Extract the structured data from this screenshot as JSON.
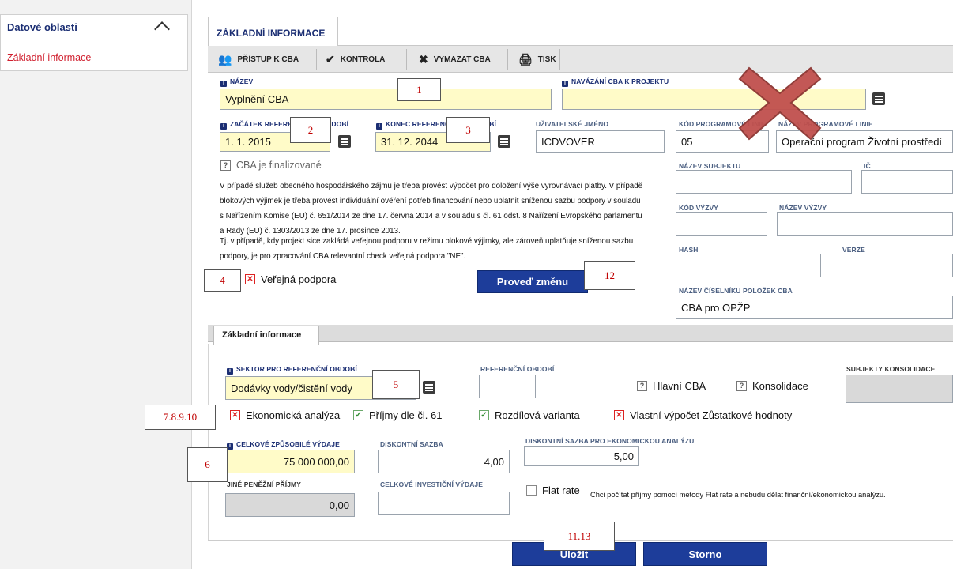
{
  "sidebar": {
    "section_title": "Datové oblasti",
    "item_active": "Základní informace"
  },
  "tabs": {
    "main": "ZÁKLADNÍ INFORMACE",
    "inner": "Základní informace"
  },
  "toolbar": {
    "access": "PŘÍSTUP K CBA",
    "check": "KONTROLA",
    "delete": "VYMAZAT CBA",
    "print": "TISK"
  },
  "form": {
    "nazev_label": "NÁZEV",
    "nazev_value": "Vyplnění CBA",
    "navazani_label": "NAVÁZÁNÍ CBA K PROJEKTU",
    "navazani_value": "",
    "zacatek_label": "ZAČÁTEK REFERENČNÍHO OBDOBÍ",
    "zacatek_value": "1. 1. 2015",
    "konec_label": "KONEC REFERENČNÍHO OBDOBÍ",
    "konec_value": "31. 12. 2044",
    "uziv_label": "UŽIVATELSKÉ JMÉNO",
    "uziv_value": "ICDVOVER",
    "kod_prog_label": "KÓD PROGRAMOVÉ LINIE",
    "kod_prog_value": "05",
    "nazev_prog_label": "NÁZEV PROGRAMOVÉ LINIE",
    "nazev_prog_value": "Operační program Životní prostředí",
    "finalized": "CBA je finalizované",
    "nazev_subjektu_label": "NÁZEV SUBJEKTU",
    "ic_label": "IČ",
    "kod_vyzvy_label": "KÓD VÝZVY",
    "nazev_vyzvy_label": "NÁZEV VÝZVY",
    "hash_label": "HASH",
    "verze_label": "VERZE",
    "ciselnik_label": "NÁZEV ČÍSELNÍKU POLOŽEK CBA",
    "ciselnik_value": "CBA pro OPŽP",
    "info_text_1": "V případě služeb obecného hospodářského zájmu je třeba provést výpočet pro doložení výše vyrovnávací platby. V případě blokových výjimek je třeba provést individuální ověření potřeb financování nebo uplatnit sníženou sazbu podpory v souladu s Nařízením Komise (EU) č. 651/2014 ze dne 17. června 2014 a v souladu s čl. 61 odst. 8 Nařízení Evropského parlamentu a Rady (EU) č. 1303/2013 ze dne 17. prosince 2013.",
    "info_text_2": "Tj. v případě, kdy projekt sice zakládá veřejnou podporu v režimu blokové výjimky, ale zároveň uplatňuje sníženou sazbu podpory, je pro zpracování CBA relevantní check veřejná podpora \"NE\".",
    "verejna_podpora": "Veřejná podpora",
    "proved_zmenu": "Proveď změnu"
  },
  "basic": {
    "sektor_label": "SEKTOR PRO REFERENČNÍ OBDOBÍ",
    "sektor_value": "Dodávky vody/čistění vody",
    "ref_obdobi_label": "REFERENČNÍ OBDOBÍ",
    "ref_obdobi_value": "",
    "hlavni_cba": "Hlavní CBA",
    "konsolidace": "Konsolidace",
    "subjekty_label": "SUBJEKTY KONSOLIDACE",
    "ekon_analyza": "Ekonomická analýza",
    "prijmy": "Příjmy dle čl. 61",
    "rozdilova": "Rozdílová varianta",
    "vlastni": "Vlastní výpočet Zůstatkové hodnoty",
    "celkove_label": "CELKOVÉ ZPŮSOBILÉ VÝDAJE",
    "celkove_value": "75 000 000,00",
    "diskont_label": "DISKONTNÍ SAZBA",
    "diskont_value": "4,00",
    "diskont_ek_label": "DISKONTNÍ SAZBA PRO EKONOMICKOU ANALÝZU",
    "diskont_ek_value": "5,00",
    "jine_label": "JINÉ PENĚŽNÍ PŘÍJMY",
    "jine_value": "0,00",
    "invest_label": "CELKOVÉ INVESTIČNÍ VÝDAJE",
    "invest_value": "",
    "flat_rate": "Flat rate",
    "flat_note": "Chci počítat příjmy pomocí metody Flat rate a nebudu dělat finanční/ekonomickou analýzu.",
    "ulozit": "Uložit",
    "storno": "Storno"
  },
  "annotations": {
    "m1": "1",
    "m2": "2",
    "m3": "3",
    "m4": "4",
    "m5": "5",
    "m6": "6",
    "m7": "7.8.9.10",
    "m11": "11.13",
    "m12": "12"
  },
  "colors": {
    "accent_red": "#c00000",
    "button_blue": "#1d3d9a",
    "required_yellow": "#fffbc8",
    "header_navy": "#1b2e73"
  }
}
